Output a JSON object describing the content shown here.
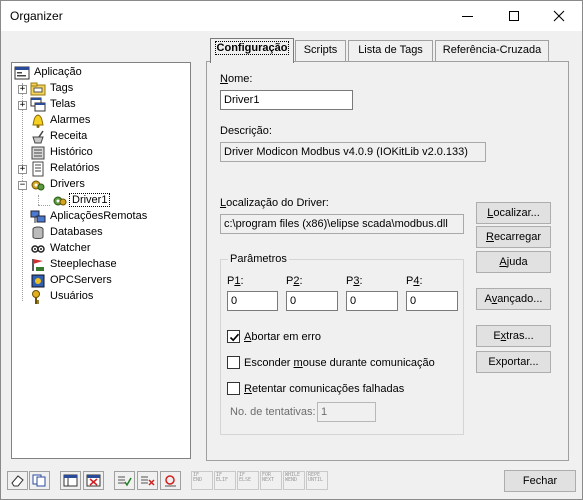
{
  "window": {
    "title": "Organizer"
  },
  "tree": {
    "items": [
      {
        "label": "Aplicação",
        "icon": "application-icon"
      },
      {
        "label": "Tags",
        "icon": "tags-folder-icon"
      },
      {
        "label": "Telas",
        "icon": "screens-icon"
      },
      {
        "label": "Alarmes",
        "icon": "alarm-bell-icon"
      },
      {
        "label": "Receita",
        "icon": "recipe-icon"
      },
      {
        "label": "Histórico",
        "icon": "history-icon"
      },
      {
        "label": "Relatórios",
        "icon": "reports-icon"
      },
      {
        "label": "Drivers",
        "icon": "drivers-icon"
      },
      {
        "label": "Driver1",
        "icon": "driver-icon"
      },
      {
        "label": "AplicaçõesRemotas",
        "icon": "remote-apps-icon"
      },
      {
        "label": "Databases",
        "icon": "database-icon"
      },
      {
        "label": "Watcher",
        "icon": "watcher-icon"
      },
      {
        "label": "Steeplechase",
        "icon": "steeplechase-icon"
      },
      {
        "label": "OPCServers",
        "icon": "opc-server-icon"
      },
      {
        "label": "Usuários",
        "icon": "users-key-icon"
      }
    ]
  },
  "tabs": [
    {
      "label": "Configuração"
    },
    {
      "label": "Scripts"
    },
    {
      "label": "Lista de Tags"
    },
    {
      "label": "Referência-Cruzada"
    }
  ],
  "config": {
    "nome_label": "Nome:",
    "nome_value": "Driver1",
    "descricao_label": "Descrição:",
    "descricao_value": "Driver Modicon Modbus v4.0.9 (IOKitLib v2.0.133)",
    "localizacao_label": "Localização do Driver:",
    "localizacao_value": "c:\\program files (x86)\\elipse scada\\modbus.dll",
    "parametros_title": "Parâmetros",
    "params": [
      {
        "label": "P1:",
        "value": "0"
      },
      {
        "label": "P2:",
        "value": "0"
      },
      {
        "label": "P3:",
        "value": "0"
      },
      {
        "label": "P4:",
        "value": "0"
      }
    ],
    "abortar_label": "Abortar em erro",
    "abortar_checked": true,
    "esconder_label": "Esconder mouse durante comunicação",
    "esconder_checked": false,
    "retentar_label": "Retentar comunicações falhadas",
    "retentar_checked": false,
    "tentativas_label": "No. de tentativas:",
    "tentativas_value": "1"
  },
  "buttons": {
    "localizar": "Localizar...",
    "recarregar": "Recarregar",
    "ajuda": "Ajuda",
    "avancado": "Avançado...",
    "extras": "Extras...",
    "exportar": "Exportar...",
    "fechar": "Fechar"
  },
  "toolbar_script_buttons": [
    {
      "line1": "IF",
      "line2": "END"
    },
    {
      "line1": "IF",
      "line2": "ELIF"
    },
    {
      "line1": "IF",
      "line2": "ELSE"
    },
    {
      "line1": "FOR",
      "line2": "NEXT"
    },
    {
      "line1": "WHILE",
      "line2": "WEND"
    },
    {
      "line1": "REPE",
      "line2": "UNTIL"
    }
  ]
}
